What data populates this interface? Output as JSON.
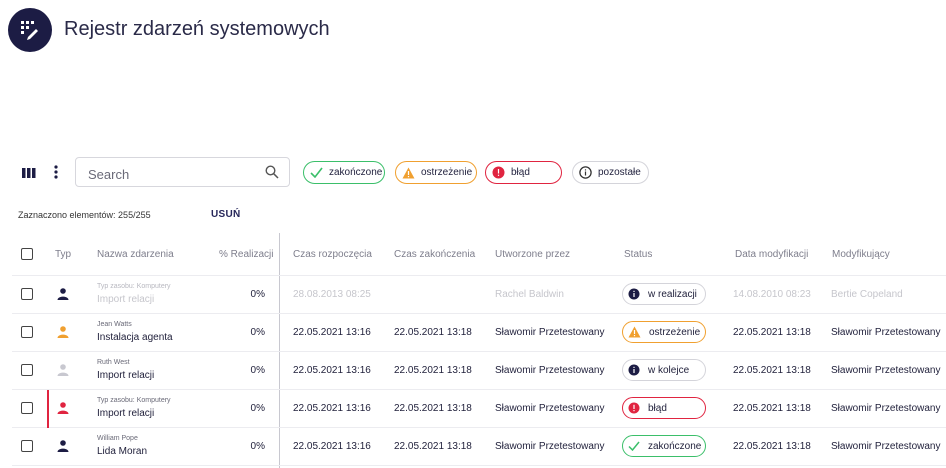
{
  "header": {
    "title": "Rejestr zdarzeń systemowych"
  },
  "toolbar": {
    "search_placeholder": "Search",
    "filters": [
      {
        "label": "zakończone",
        "color": "#3bbf6a"
      },
      {
        "label": "ostrzeżenie",
        "color": "#f0a030"
      },
      {
        "label": "błąd",
        "color": "#e02440"
      },
      {
        "label": "pozostałe",
        "color": "#c8c8d0"
      }
    ]
  },
  "selection": {
    "info": "Zaznaczono elementów: 255/255",
    "delete_label": "USUŃ"
  },
  "table": {
    "columns": [
      "Typ",
      "Nazwa zdarzenia",
      "% Realizacji",
      "Czas rozpoczęcia",
      "Czas zakończenia",
      "Utworzone przez",
      "Status",
      "Data modyfikacji",
      "Modyfikujący"
    ],
    "rows": [
      {
        "sub": "Typ zasobu: Komputery",
        "name": "Import relacji",
        "percent": "0%",
        "start": "28.08.2013 08:25",
        "end": "",
        "created_by": "Rachel Baldwin",
        "status": "w realizacji",
        "modified": "14.08.2010 08:23",
        "modifier": "Bertie Copeland",
        "icon_color": "#1c1c44",
        "status_color": "#c8c8d0",
        "dim": true
      },
      {
        "sub": "Jean Watts",
        "name": "Instalacja agenta",
        "percent": "0%",
        "start": "22.05.2021 13:16",
        "end": "22.05.2021 13:18",
        "created_by": "Sławomir Przetestowany",
        "status": "ostrzeżenie",
        "modified": "22.05.2021 13:18",
        "modifier": "Sławomir Przetestowany",
        "icon_color": "#f0a030",
        "status_color": "#f0a030"
      },
      {
        "sub": "Ruth West",
        "name": "Import relacji",
        "percent": "0%",
        "start": "22.05.2021 13:16",
        "end": "22.05.2021 13:18",
        "created_by": "Sławomir Przetestowany",
        "status": "w kolejce",
        "modified": "22.05.2021 13:18",
        "modifier": "Sławomir Przetestowany",
        "icon_color": "#c8c8d0",
        "status_color": "#c8c8d0"
      },
      {
        "sub": "Typ zasobu: Komputery",
        "name": "Import relacji",
        "percent": "0%",
        "start": "22.05.2021 13:16",
        "end": "22.05.2021 13:18",
        "created_by": "Sławomir Przetestowany",
        "status": "błąd",
        "modified": "22.05.2021 13:18",
        "modifier": "Sławomir Przetestowany",
        "icon_color": "#e02440",
        "status_color": "#e02440",
        "marked": true
      },
      {
        "sub": "William Pope",
        "name": "Lida Moran",
        "percent": "0%",
        "start": "22.05.2021 13:16",
        "end": "22.05.2021 13:18",
        "created_by": "Sławomir Przetestowany",
        "status": "zakończone",
        "modified": "22.05.2021 13:18",
        "modifier": "Sławomir Przetestowany",
        "icon_color": "#1c1c44",
        "status_color": "#3bbf6a"
      }
    ]
  }
}
